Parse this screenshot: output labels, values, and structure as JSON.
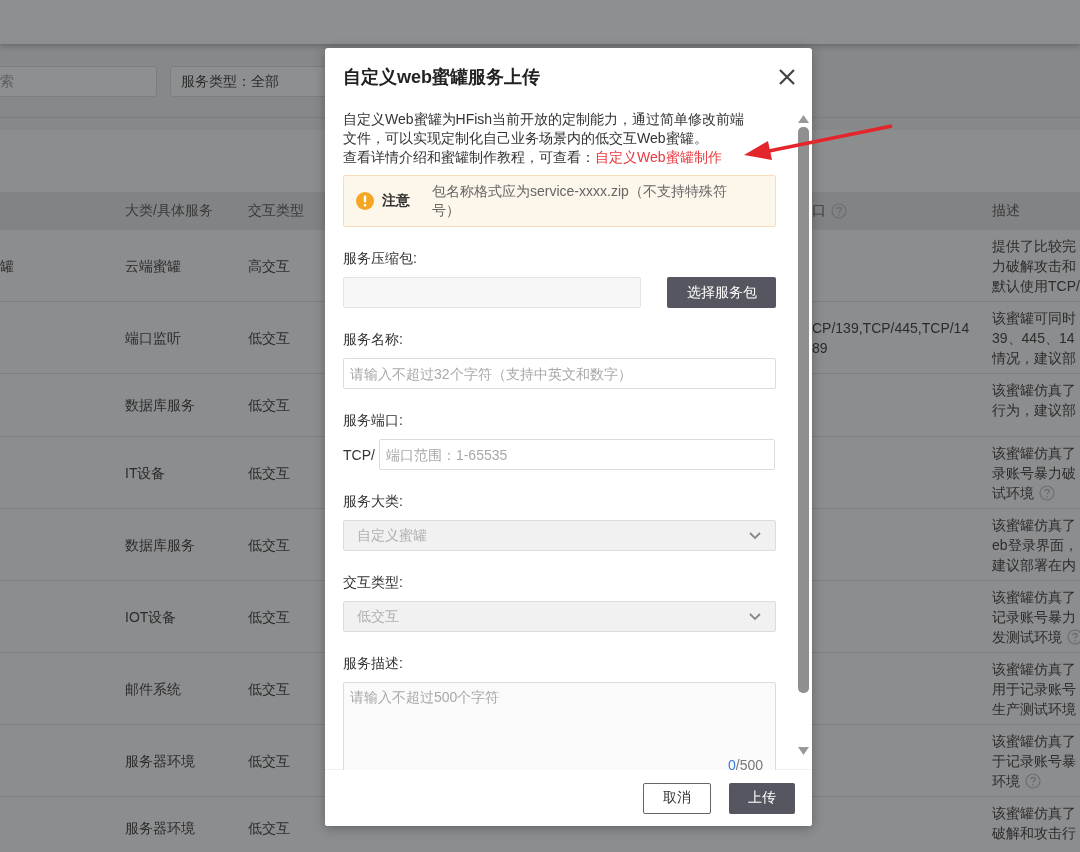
{
  "page": {
    "search": {
      "placeholder": "索"
    },
    "filter": {
      "label": "服务类型：全部"
    },
    "table": {
      "columns": [
        {
          "label": "大类/具体服务",
          "help": false
        },
        {
          "label": "交互类型",
          "help": false
        },
        {
          "label": "口",
          "help": true
        },
        {
          "label": "描述",
          "help": false
        }
      ],
      "rows": [
        {
          "name": "罐",
          "category": "云端蜜罐",
          "interaction": "高交互",
          "description": [
            "提供了比较完",
            "力破解攻击和",
            "默认使用TCP/"
          ],
          "help": false
        },
        {
          "category": "端口监听",
          "interaction": "低交互",
          "port": [
            "CP/139,TCP/445,TCP/14",
            "89"
          ],
          "description": [
            "该蜜罐可同时",
            "39、445、14",
            "情况，建议部"
          ],
          "help": false
        },
        {
          "category": "数据库服务",
          "interaction": "低交互",
          "description": [
            "该蜜罐仿真了",
            "行为，建议部"
          ],
          "help": false
        },
        {
          "category": "IT设备",
          "interaction": "低交互",
          "description": [
            "该蜜罐仿真了",
            "录账号暴力破",
            "试环境"
          ],
          "help": true
        },
        {
          "category": "数据库服务",
          "interaction": "低交互",
          "description": [
            "该蜜罐仿真了",
            "eb登录界面，",
            "建议部署在内"
          ],
          "help": false
        },
        {
          "category": "IOT设备",
          "interaction": "低交互",
          "description": [
            "该蜜罐仿真了",
            "记录账号暴力",
            "发测试环境"
          ],
          "help": true
        },
        {
          "category": "邮件系统",
          "interaction": "低交互",
          "description": [
            "该蜜罐仿真了",
            "用于记录账号",
            "生产测试环境"
          ],
          "help": false
        },
        {
          "category": "服务器环境",
          "interaction": "低交互",
          "description": [
            "该蜜罐仿真了",
            "于记录账号暴",
            "环境"
          ],
          "help": true
        },
        {
          "category": "服务器环境",
          "interaction": "低交互",
          "description": [
            "该蜜罐仿真了",
            "破解和攻击行"
          ],
          "help": false
        }
      ]
    }
  },
  "dialog": {
    "title": "自定义web蜜罐服务上传",
    "intro": "自定义Web蜜罐为HFish当前开放的定制能力，通过简单修改前端文件，可以实现定制化自己业务场景内的低交互Web蜜罐。",
    "link_prefix": "查看详情介绍和蜜罐制作教程，可查看：",
    "link": "自定义Web蜜罐制作",
    "notice": {
      "label": "注意",
      "text": "包名称格式应为service-xxxx.zip（不支持特殊符号）"
    },
    "fields": [
      {
        "kind": "file",
        "label": "服务压缩包:",
        "button": "选择服务包"
      },
      {
        "kind": "text",
        "label": "服务名称:",
        "placeholder": "请输入不超过32个字符（支持中英文和数字）"
      },
      {
        "kind": "port",
        "label": "服务端口:",
        "prefix": "TCP/",
        "placeholder": "端口范围：1-65535"
      },
      {
        "kind": "select",
        "label": "服务大类:",
        "value": "自定义蜜罐",
        "disabled": true
      },
      {
        "kind": "select",
        "label": "交互类型:",
        "value": "低交互",
        "disabled": true
      },
      {
        "kind": "textarea",
        "label": "服务描述:",
        "placeholder": "请输入不超过500个字符",
        "count": "0",
        "limit": "/500"
      }
    ],
    "buttons": [
      {
        "label": "取消",
        "kind": "secondary"
      },
      {
        "label": "上传",
        "kind": "primary"
      }
    ]
  }
}
